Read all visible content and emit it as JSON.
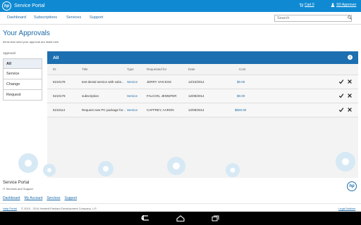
{
  "header": {
    "logo_text": "hp",
    "app_title": "Service Portal",
    "cart_label": "Cart 0",
    "user_label": "SD Approver"
  },
  "nav": {
    "items": [
      "Dashboard",
      "Subscriptions",
      "Services",
      "Support"
    ],
    "search_placeholder": "Search"
  },
  "page": {
    "title": "Your Approvals",
    "subtitle": "Items that need your approval are listed here"
  },
  "filter": {
    "label": "Approval",
    "items": [
      "All",
      "Service",
      "Change",
      "Request"
    ],
    "active_index": 0
  },
  "panel": {
    "title": "All",
    "columns": [
      "ID",
      "Title",
      "Type",
      "Requested for",
      "Date",
      "Cost"
    ],
    "rows": [
      {
        "id": "5210178",
        "title": "test denial service with subs...",
        "type": "Service",
        "requested_for": "JERRY VAN ESS",
        "date": "12/10/2014",
        "cost": "$0.00"
      },
      {
        "id": "5210179",
        "title": "subscription",
        "type": "Service",
        "requested_for": "FALCON, JENNIFER",
        "date": "12/09/2014",
        "cost": "$0.00"
      },
      {
        "id": "5210114",
        "title": "Request new PC package for...",
        "type": "Service",
        "requested_for": "CAFFREY, AARON",
        "date": "12/09/2014",
        "cost": "$500.00"
      }
    ]
  },
  "footer": {
    "title": "Service Portal",
    "subtitle": "IT Services and Support",
    "links": [
      "Dashboard",
      "My Account",
      "Services",
      "Support"
    ],
    "help": "Help Portal",
    "copyright": "© 2010 - 2014 Hewlett-Packard Development Company, L.P.",
    "legal": "Legal Notices",
    "logo_text": "hp"
  },
  "colors": {
    "brand_blue": "#0f8ad2",
    "panel_header": "#1c6fb0",
    "link": "#1b6aa8"
  }
}
